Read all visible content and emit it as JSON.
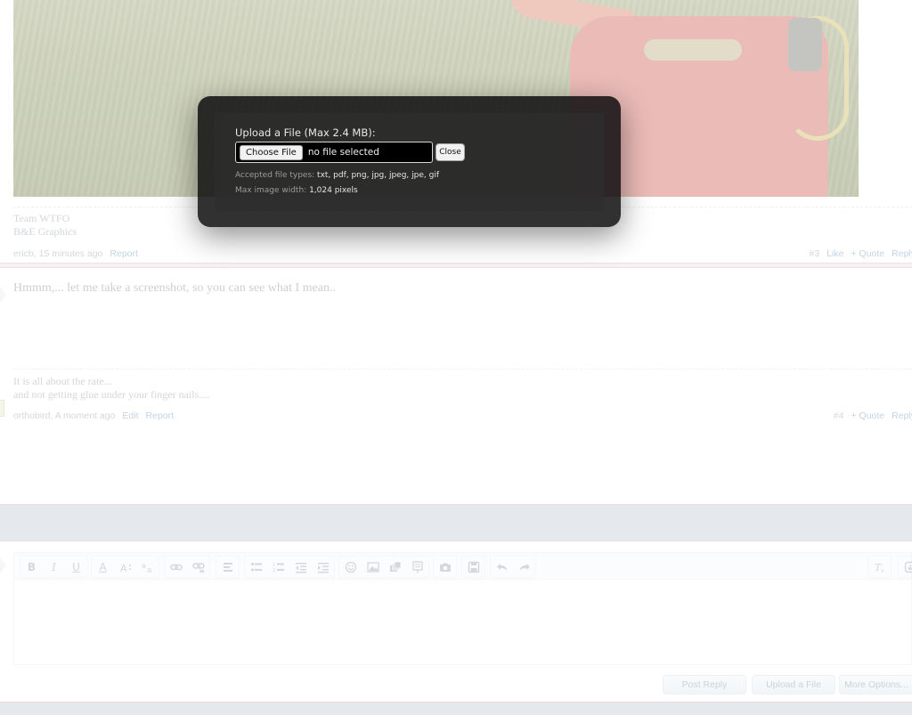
{
  "post3": {
    "signature_line1": "Team WTFO",
    "signature_line2": "B&E Graphics",
    "author": "ericb",
    "time": ", 15 minutes ago",
    "report": "Report",
    "number": "#3",
    "like": "Like",
    "quote": "+ Quote",
    "reply": "Reply"
  },
  "post4": {
    "body": "Hmmm,... let me take a screenshot, so you can see what I mean..",
    "signature_line1": "It is all about the rate...",
    "signature_line2": "and not getting glue under your finger nails....",
    "author": "orthobird",
    "time": ", A moment ago",
    "edit": "Edit",
    "report": "Report",
    "number": "#4",
    "quote": "+ Quote",
    "reply": "Reply"
  },
  "editor": {
    "font_size_label": "A",
    "post_reply": "Post Reply",
    "upload_file": "Upload a File",
    "more_options": "More Options..."
  },
  "upload_modal": {
    "title": "Upload a File (Max 2.4 MB):",
    "choose_file": "Choose File",
    "no_file": "no file selected",
    "close": "Close",
    "accepted_label": "Accepted file types: ",
    "accepted_types": "txt, pdf, png, jpg, jpeg, jpe, gif",
    "max_width_label": "Max image width: ",
    "max_width_value": "1,024 pixels"
  }
}
